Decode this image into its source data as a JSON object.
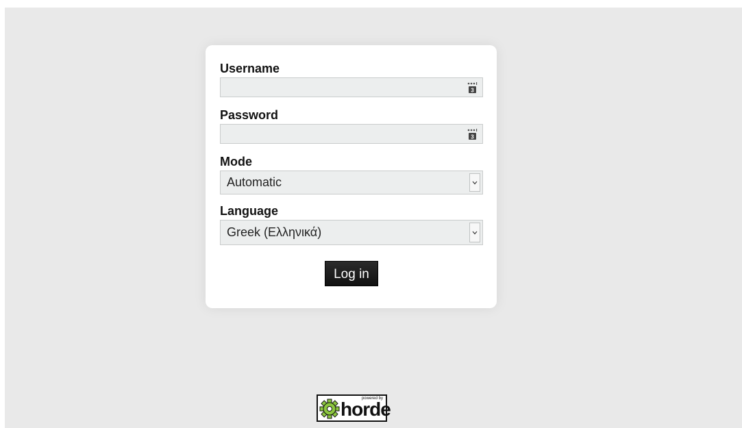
{
  "form": {
    "username": {
      "label": "Username",
      "value": "",
      "placeholder": ""
    },
    "password": {
      "label": "Password",
      "value": "",
      "placeholder": ""
    },
    "mode": {
      "label": "Mode",
      "selected": "Automatic"
    },
    "language": {
      "label": "Language",
      "selected": "Greek (Ελληνικά)"
    },
    "submit_label": "Log in"
  },
  "footer": {
    "powered_text": "powered by",
    "brand_text": "horde"
  },
  "colors": {
    "background": "#e9e9e9",
    "card": "#ffffff",
    "input_bg": "#eceeee",
    "button_bg": "#1a1a1a",
    "logo_green": "#8cc63f"
  }
}
